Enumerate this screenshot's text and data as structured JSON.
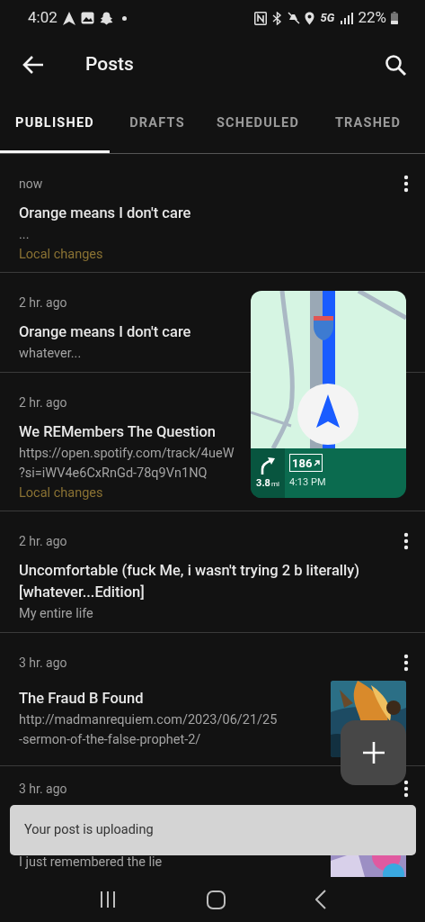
{
  "status_bar": {
    "time": "4:02",
    "network": "5G",
    "battery": "22%"
  },
  "app_bar": {
    "title": "Posts"
  },
  "tabs": [
    {
      "label": "PUBLISHED",
      "selected": true
    },
    {
      "label": "DRAFTS",
      "selected": false
    },
    {
      "label": "SCHEDULED",
      "selected": false
    },
    {
      "label": "TRASHED",
      "selected": false
    }
  ],
  "posts": [
    {
      "time": "now",
      "title": "Orange means I don't care",
      "excerpt": [
        "..."
      ],
      "status": "Local changes",
      "menu": true
    },
    {
      "time": "2 hr. ago",
      "title": "Orange means I don't care",
      "excerpt": [
        "whatever..."
      ],
      "menu": false
    },
    {
      "time": "2 hr. ago",
      "title": "We REMembers The Question",
      "excerpt": [
        "https://open.spotify.com/track/4ueW",
        "?si=iWV4e6CxRnGd-78q9Vn1NQ"
      ],
      "status": "Local changes",
      "menu": false
    },
    {
      "time": "2 hr. ago",
      "title": "Uncomfortable (fuck Me, i wasn't trying 2 b literally) [whatever...Edition]",
      "excerpt": [
        "My entire life"
      ],
      "menu": true
    },
    {
      "time": "3 hr. ago",
      "title": "The Fraud B Found",
      "excerpt": [
        "http://madmanrequiem.com/2023/06/21/25",
        "-sermon-of-the-false-prophet-2/"
      ],
      "menu": true,
      "thumbnail": {
        "kind": "picture"
      }
    },
    {
      "time": "3 hr. ago",
      "excerpt": [
        "I just remembered the lie"
      ],
      "menu": true,
      "thumbnail": {
        "kind": "picture"
      }
    }
  ],
  "navigation_overlay": {
    "distance": "3.8",
    "unit": "mi",
    "exit": "186",
    "eta": "4:13 PM"
  },
  "snackbar": {
    "message": "Your post is uploading"
  }
}
